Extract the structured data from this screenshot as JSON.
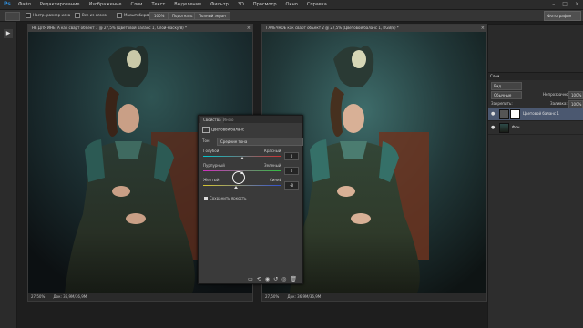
{
  "menubar": {
    "logo": "Ps",
    "items": [
      "Файл",
      "Редактирование",
      "Изображение",
      "Слои",
      "Текст",
      "Выделение",
      "Фильтр",
      "3D",
      "Просмотр",
      "Окно",
      "Справка"
    ],
    "window_buttons": [
      "–",
      "□",
      "×"
    ]
  },
  "options_bar": {
    "sample_size": "Настр. размер иска",
    "all_layers": "Все из слоев",
    "auto_enhance": "Масштабирование",
    "edge_label": "100%",
    "refine": "Подогнать",
    "full_screen": "Полный экран",
    "workspace": "Фотография"
  },
  "toolbox": {
    "tool_icon": "play-icon",
    "tool_glyph": "▶"
  },
  "doc_left": {
    "tab": "НЕ ДЛЯ ИНЕТА как сварт объект 1 @ 27,5% (Цветовой баланс 1, Слой-маску/8) *",
    "close": "×",
    "zoom": "27,50%",
    "doc_info": "Док: 36,9М/36,9М"
  },
  "doc_right": {
    "tab": "ГАЛЕЧНОЕ как сварт объект 2 @ 27,5% (Цветовой баланс 1, RGB/8) *",
    "close": "×",
    "zoom": "27,50%",
    "doc_info": "Док: 36,9М/36,9М"
  },
  "properties": {
    "tabs": [
      "Свойства",
      "Инфо"
    ],
    "title": "Цветовой баланс",
    "tone_label": "Тон:",
    "tone_value": "Средние тона",
    "sliders": [
      {
        "left": "Голубой",
        "right": "Красный",
        "value": "0",
        "fraction": 0.5
      },
      {
        "left": "Пурпурный",
        "right": "Зеленый",
        "value": "0",
        "fraction": 0.5
      },
      {
        "left": "Желтый",
        "right": "Синий",
        "value": "-8",
        "fraction": 0.42
      }
    ],
    "preserve": "Сохранить яркость",
    "bottom_icons": [
      "▭",
      "⟲",
      "◉",
      "↺",
      "◎",
      "🗑"
    ]
  },
  "layers_panel": {
    "tab": "Слои",
    "kind": "Вид",
    "blend_mode": "Обычные",
    "opacity_label": "Непрозрачность:",
    "opacity_value": "100%",
    "lock_label": "Закрепить:",
    "fill_label": "Заливка:",
    "fill_value": "100%",
    "layers": [
      {
        "name": "Цветовой баланс 1",
        "selected": true
      },
      {
        "name": "Фон",
        "selected": false
      }
    ]
  }
}
